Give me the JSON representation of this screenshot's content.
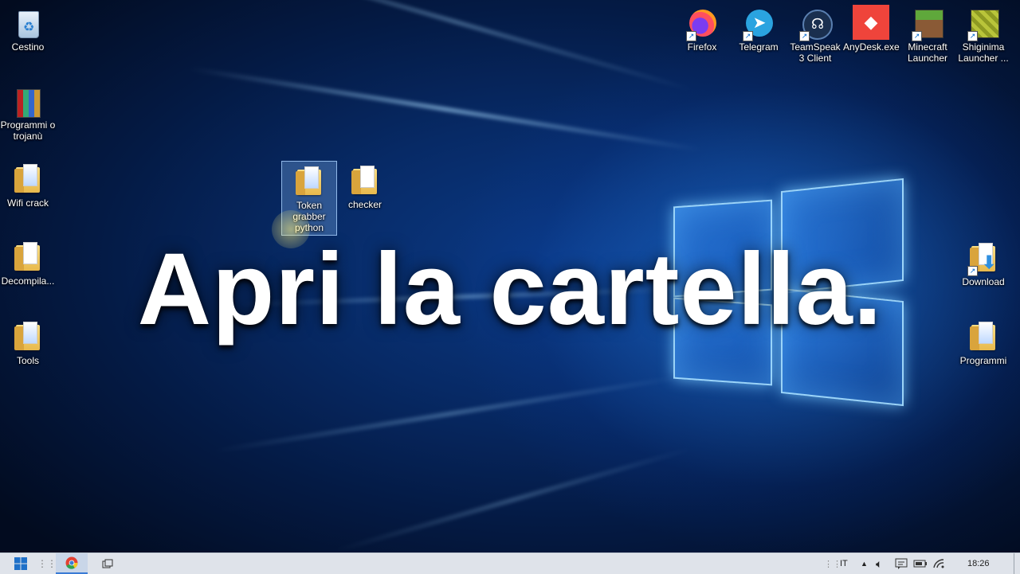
{
  "caption": "Apri la cartella.",
  "desktop_left": [
    {
      "label": "Cestino",
      "icon": "recycle-bin-icon"
    },
    {
      "label": "Programmi o trojanù",
      "icon": "archive-icon"
    },
    {
      "label": "Wifi crack",
      "icon": "folder-icon"
    },
    {
      "label": "Decompila...",
      "icon": "folder-icon"
    },
    {
      "label": "Tools",
      "icon": "folder-icon"
    }
  ],
  "desktop_top_right": [
    {
      "label": "Firefox",
      "icon": "firefox-icon"
    },
    {
      "label": "Telegram",
      "icon": "telegram-icon"
    },
    {
      "label": "TeamSpeak 3 Client",
      "icon": "teamspeak-icon"
    },
    {
      "label": "AnyDesk.exe",
      "icon": "anydesk-icon"
    },
    {
      "label": "Minecraft Launcher",
      "icon": "minecraft-icon"
    },
    {
      "label": "Shiginima Launcher ...",
      "icon": "shiginima-icon"
    }
  ],
  "desktop_right": [
    {
      "label": "Download",
      "icon": "download-folder-icon"
    },
    {
      "label": "Programmi",
      "icon": "folder-icon"
    }
  ],
  "desktop_center": [
    {
      "label": "Token grabber python",
      "icon": "folder-icon",
      "selected": true
    },
    {
      "label": "checker",
      "icon": "folder-icon"
    }
  ],
  "taskbar": {
    "language": "IT",
    "time": "18:26"
  }
}
